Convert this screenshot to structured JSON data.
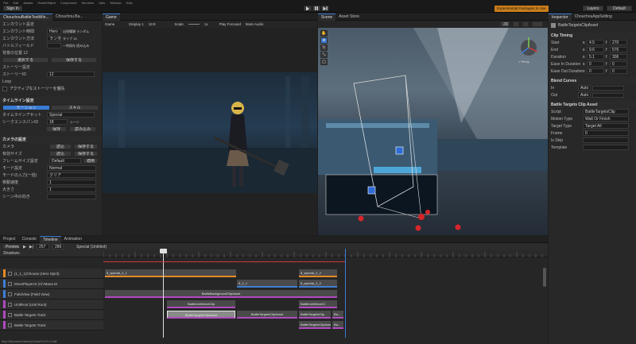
{
  "menubar": {
    "items": [
      "File",
      "Edit",
      "Assets",
      "GameObject",
      "Component",
      "Services",
      "Jobs",
      "Window",
      "Help"
    ],
    "status_label": "Experimental Packages In Use"
  },
  "toolbar": {
    "account": "Sign In",
    "layers": "Layers",
    "layout": "Default"
  },
  "inspector_left": {
    "tabs": [
      "ChouchouBattleTestWin...",
      "Chouchou.Ba..."
    ],
    "rows": [
      {
        "label": "エンカウント設定",
        "value": ""
      },
      {
        "label": "エンカウント時間",
        "value": "Hero",
        "extra": "出現種類 ランダム"
      },
      {
        "label": "エンカウント方法",
        "value": "ランダム",
        "extra": "タイプ 15"
      },
      {
        "label": "バトルフィールド",
        "value": "",
        "extra": "一時保存 読み込み"
      },
      {
        "label": "背景の位置 12",
        "value": ""
      },
      {
        "label": "",
        "button1": "選択する",
        "button2": "保存する"
      },
      {
        "label": "ストーリー設定",
        "value": ""
      },
      {
        "label": "ストーリーID",
        "value": "12"
      },
      {
        "label": "Loop",
        "value": ""
      },
      {
        "label": "アクティブなストーリーを優先",
        "value": ""
      }
    ],
    "timeline_section": "タイムライン設定",
    "mode_toggle": [
      "モーション",
      "スキル"
    ],
    "timeline_rows": [
      {
        "label": "タイムラインアセット",
        "value": "Special"
      },
      {
        "label": "シークエンスパンID",
        "value": "18",
        "extra": "シーン"
      },
      {
        "label": "",
        "button1": "保存",
        "button2": "読み込み"
      }
    ],
    "camera_section": "カメラの設定",
    "camera_rows": [
      {
        "label": "カメラ",
        "b1": "読込",
        "b2": "保存する"
      },
      {
        "label": "有効サイズ",
        "b1": "読込",
        "b2": "保存する"
      },
      {
        "label": "フレームサイズ設定",
        "value": "Default",
        "b2": "適用"
      },
      {
        "label": "モード設定",
        "value": "Normal"
      },
      {
        "label": "モードの入力(一括)",
        "value": "クリア"
      },
      {
        "label": "移動速度",
        "value": "1"
      },
      {
        "label": "大きさ",
        "value": "1"
      },
      {
        "label": "シーン中の向き",
        "value": ""
      }
    ]
  },
  "game_view": {
    "tab": "Game",
    "toolbar": {
      "mode": "Game",
      "display": "Display 1",
      "aspect": "16:9",
      "scale_label": "Scale",
      "scale_value": "1x",
      "play_focused": "Play Focused",
      "mute": "Mute Audio"
    }
  },
  "scene_view": {
    "tabs": [
      "Scene",
      "Asset Store"
    ],
    "persp_label": "< Persp",
    "zoom": "2D"
  },
  "inspector_right": {
    "tabs": [
      "Inspector",
      "ChouchouAppSetting"
    ],
    "object_name": "BattleTargetsClipAsset",
    "clip_timing": "Clip Timing",
    "timing_rows": [
      {
        "label": "Start",
        "unit": "s",
        "v1": "4.5",
        "f": "f",
        "v2": "270"
      },
      {
        "label": "End",
        "unit": "s",
        "v1": "9.6",
        "f": "f",
        "v2": "576"
      },
      {
        "label": "Duration",
        "unit": "s",
        "v1": "5.1",
        "f": "f",
        "v2": "306"
      },
      {
        "label": "Ease In Duration",
        "unit": "s",
        "v1": "0",
        "f": "f",
        "v2": "0"
      },
      {
        "label": "Ease Out Duration",
        "unit": "s",
        "v1": "0",
        "f": "f",
        "v2": "0"
      }
    ],
    "blend_curves": "Blend Curves",
    "blend_rows": [
      {
        "label": "In",
        "value": "Auto"
      },
      {
        "label": "Out",
        "value": "Auto"
      }
    ],
    "asset_section": "Battle Targets Clip Asset",
    "asset_rows": [
      {
        "label": "Script",
        "value": "BattleTargetsClip"
      },
      {
        "label": "Motion Type",
        "value": "Wait Or Finish"
      },
      {
        "label": "Target Type",
        "value": "Target All"
      },
      {
        "label": "Frame",
        "value": "0"
      },
      {
        "label": "Is Skip",
        "value": ""
      },
      {
        "label": "Template",
        "value": ""
      }
    ]
  },
  "bottom": {
    "tabs": [
      "Project",
      "Console",
      "Timeline",
      "Animation"
    ],
    "preview_label": "Preview",
    "frame": "257",
    "frame2": "286",
    "timeline_asset": "Special (Untitled)",
    "track_header": "Shadows",
    "tracks": [
      {
        "name": "(1_1_1)Chouse (Hero Spirit)",
        "color": "#e58a25"
      },
      {
        "name": "MovePlayerUI (Ch'Mana M",
        "color": "#3d7fd6"
      },
      {
        "name": "FieldView (Field View)",
        "color": "#3d7fd6"
      },
      {
        "name": "UnitRoot (Unit Root)",
        "color": "#b04ac0"
      },
      {
        "name": "Battle Targets Track",
        "color": "#b04ac0"
      },
      {
        "name": "Battle Targets Track",
        "color": "#b04ac0"
      }
    ],
    "clips": {
      "c1": "5_special_2_1",
      "c2": "5_special_2_2",
      "c3": "5_2_1",
      "c4": "5_special_2_2",
      "c5": "BattleBackgroundClipAsset",
      "c6": "BattleUnitMoveClip",
      "c7": "BattleUnitMoveCl",
      "c8": "BattleTargetsClipAsset",
      "c9": "BattleTargetsClipAsset",
      "c10": "BattleTargetsClip",
      "c11": "Ba...",
      "c12": "BattleTargetsClipAsset",
      "c13": "Ba..."
    },
    "status_url": "http://tripostore/aetrq/ClosePc/XX.e7a8"
  },
  "colors": {
    "accent": "#3a7bd5",
    "orange_track": "#e58a25",
    "blue_track": "#3d7fd6",
    "purple_track": "#b04ac0",
    "playhead": "#e0e0e0",
    "end_marker": "#d43b3b"
  },
  "icons": {
    "play": "play-icon",
    "pause": "pause-icon",
    "step": "step-icon",
    "hand": "hand-tool-icon",
    "move": "move-tool-icon",
    "rotate": "rotate-tool-icon",
    "scale": "scale-tool-icon",
    "rect": "rect-tool-icon",
    "gizmo": "scene-gizmo-icon"
  }
}
